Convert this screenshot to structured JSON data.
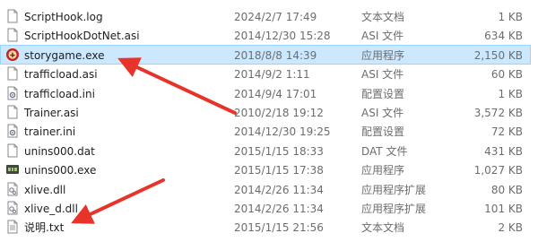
{
  "files": [
    {
      "name": "ScriptHook.log",
      "date": "2024/2/7 17:49",
      "type": "文本文档",
      "size": "1 KB",
      "icon": "document-icon",
      "selected": false
    },
    {
      "name": "ScriptHookDotNet.asi",
      "date": "2014/12/30 15:28",
      "type": "ASI 文件",
      "size": "634 KB",
      "icon": "document-icon",
      "selected": false
    },
    {
      "name": "storygame.exe",
      "date": "2018/8/8 14:39",
      "type": "应用程序",
      "size": "2,150 KB",
      "icon": "app-red-icon",
      "selected": true
    },
    {
      "name": "trafficload.asi",
      "date": "2014/9/2 1:11",
      "type": "ASI 文件",
      "size": "60 KB",
      "icon": "document-icon",
      "selected": false
    },
    {
      "name": "trafficload.ini",
      "date": "2014/9/4 17:01",
      "type": "配置设置",
      "size": "1 KB",
      "icon": "settings-file-icon",
      "selected": false
    },
    {
      "name": "Trainer.asi",
      "date": "2010/2/18 19:12",
      "type": "ASI 文件",
      "size": "3,572 KB",
      "icon": "document-icon",
      "selected": false
    },
    {
      "name": "trainer.ini",
      "date": "2014/12/30 19:25",
      "type": "配置设置",
      "size": "72 KB",
      "icon": "settings-file-icon",
      "selected": false
    },
    {
      "name": "unins000.dat",
      "date": "2015/1/15 18:33",
      "type": "DAT 文件",
      "size": "431 KB",
      "icon": "document-icon",
      "selected": false
    },
    {
      "name": "unins000.exe",
      "date": "2015/1/15 17:38",
      "type": "应用程序",
      "size": "1,027 KB",
      "icon": "gta-app-icon",
      "selected": false
    },
    {
      "name": "xlive.dll",
      "date": "2014/2/26 11:34",
      "type": "应用程序扩展",
      "size": "80 KB",
      "icon": "dll-file-icon",
      "selected": false
    },
    {
      "name": "xlive_d.dll",
      "date": "2014/2/26 11:34",
      "type": "应用程序扩展",
      "size": "101 KB",
      "icon": "dll-file-icon",
      "selected": false
    },
    {
      "name": "说明.txt",
      "date": "2015/1/15 21:56",
      "type": "文本文档",
      "size": "2 KB",
      "icon": "text-file-icon",
      "selected": false
    }
  ],
  "colors": {
    "selection": "#cce8ff",
    "selection_border": "#99d1ff",
    "annotation_arrow": "#e8332a"
  }
}
